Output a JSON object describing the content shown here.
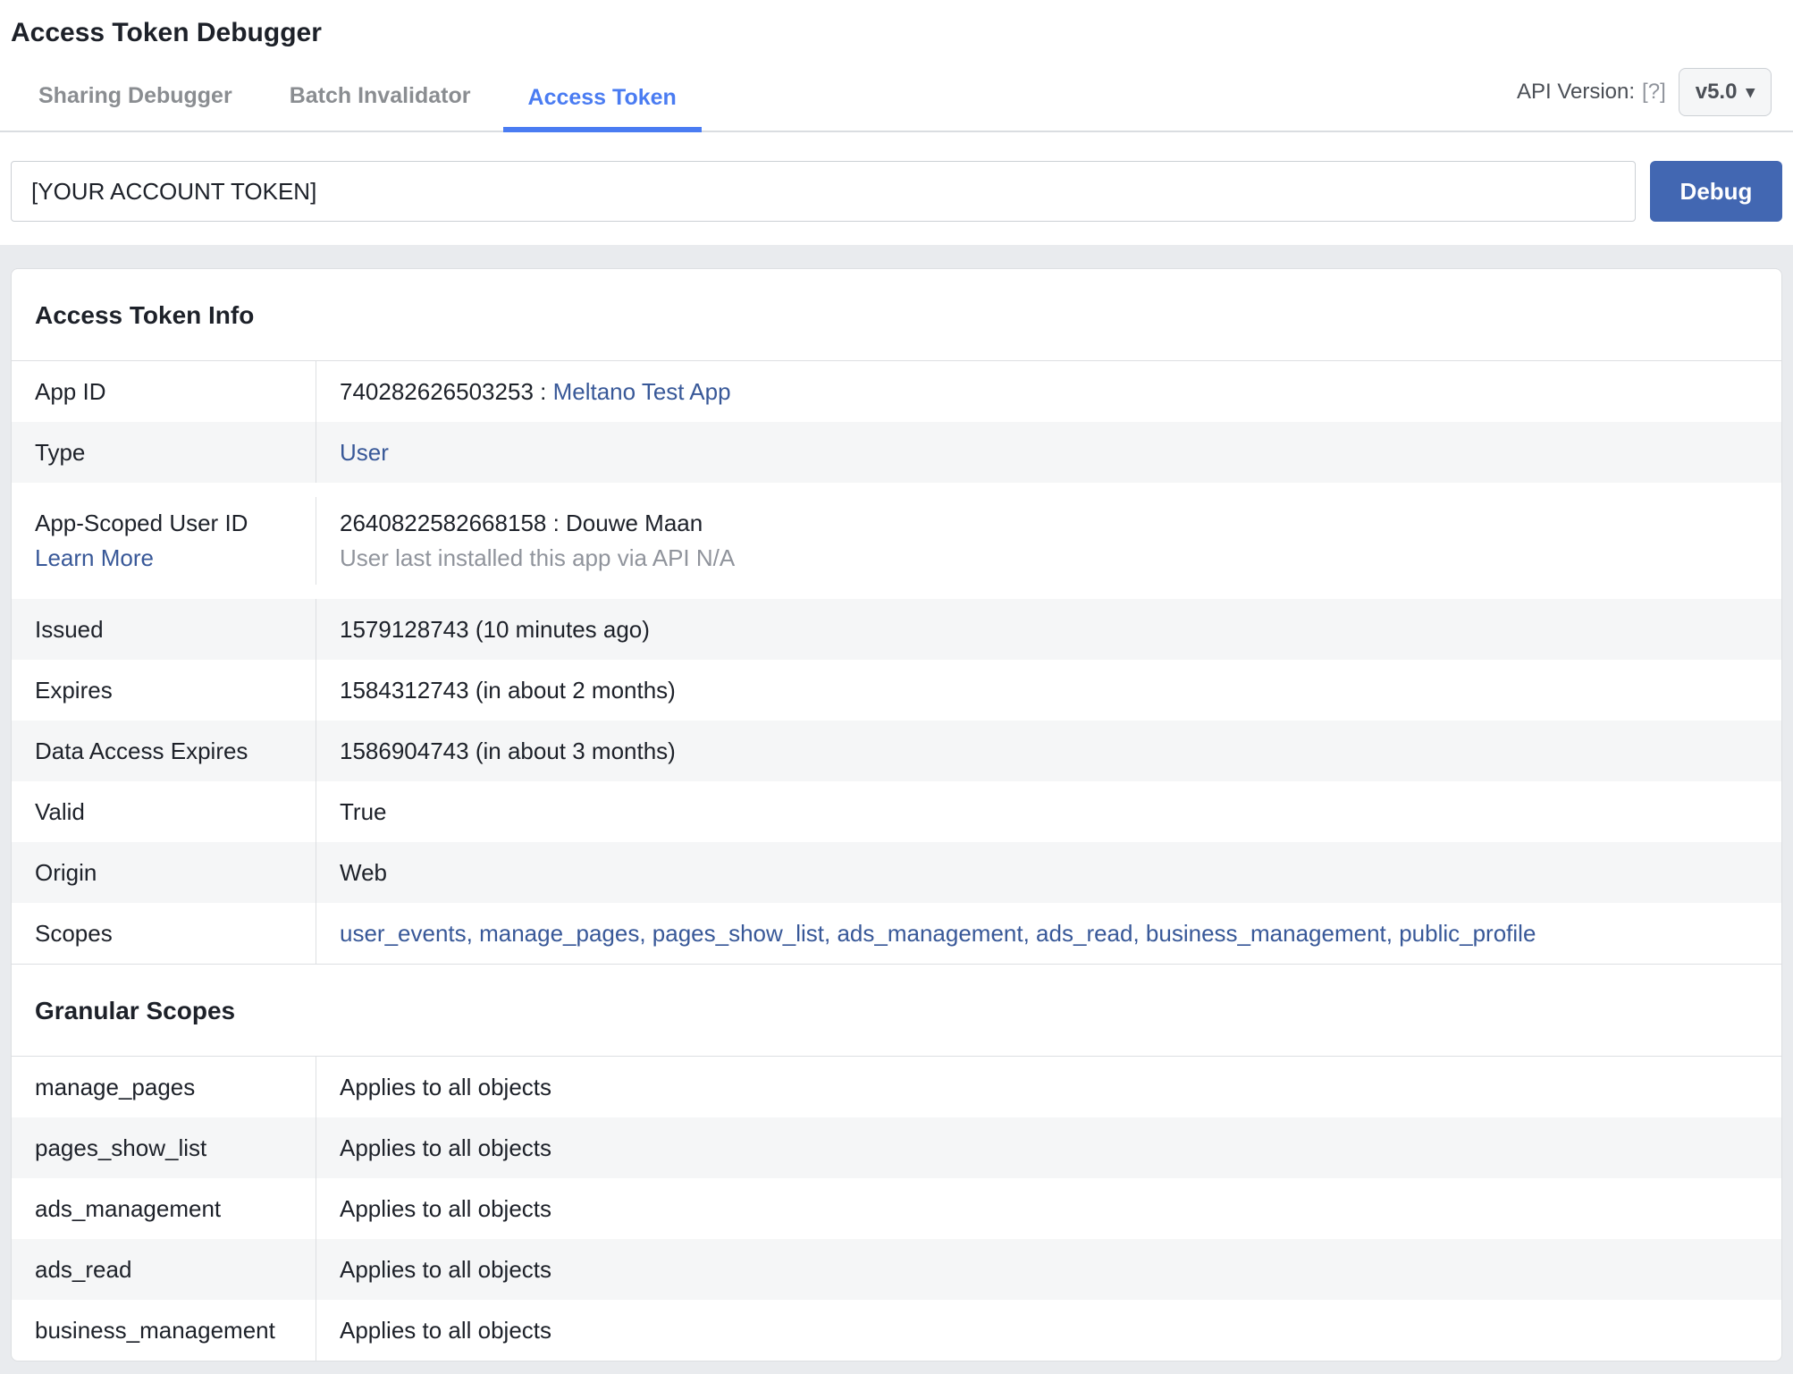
{
  "page_title": "Access Token Debugger",
  "tabs": [
    {
      "label": "Sharing Debugger",
      "active": false
    },
    {
      "label": "Batch Invalidator",
      "active": false
    },
    {
      "label": "Access Token",
      "active": true
    }
  ],
  "api_version": {
    "label": "API Version:",
    "help": "[?]",
    "value": "v5.0",
    "caret": "▾"
  },
  "token_form": {
    "input_value": "[YOUR ACCOUNT TOKEN]",
    "debug_label": "Debug"
  },
  "info": {
    "heading": "Access Token Info",
    "rows": {
      "app_id": {
        "label": "App ID",
        "value_prefix": "740282626503253 : ",
        "value_link": "Meltano Test App"
      },
      "type": {
        "label": "Type",
        "value_link": "User"
      },
      "asid": {
        "label": "App-Scoped User ID",
        "label_link": "Learn More",
        "value": "2640822582668158 : Douwe Maan",
        "note": "User last installed this app via API N/A"
      },
      "issued": {
        "label": "Issued",
        "value": "1579128743 (10 minutes ago)"
      },
      "expires": {
        "label": "Expires",
        "value": "1584312743 (in about 2 months)"
      },
      "data_access_expires": {
        "label": "Data Access Expires",
        "value": "1586904743 (in about 3 months)"
      },
      "valid": {
        "label": "Valid",
        "value": "True"
      },
      "origin": {
        "label": "Origin",
        "value": "Web"
      },
      "scopes": {
        "label": "Scopes",
        "value": "user_events, manage_pages, pages_show_list, ads_management, ads_read, business_management, public_profile"
      }
    }
  },
  "granular": {
    "heading": "Granular Scopes",
    "rows": [
      {
        "name": "manage_pages",
        "value": "Applies to all objects"
      },
      {
        "name": "pages_show_list",
        "value": "Applies to all objects"
      },
      {
        "name": "ads_management",
        "value": "Applies to all objects"
      },
      {
        "name": "ads_read",
        "value": "Applies to all objects"
      },
      {
        "name": "business_management",
        "value": "Applies to all objects"
      }
    ]
  },
  "colors": {
    "active_tab_blue": "#4a7cf2",
    "link_blue": "#385898",
    "debug_button_blue": "#4267b2",
    "page_background": "#e9ebee",
    "row_alternate": "#f5f6f7",
    "muted_text": "#90949c"
  }
}
